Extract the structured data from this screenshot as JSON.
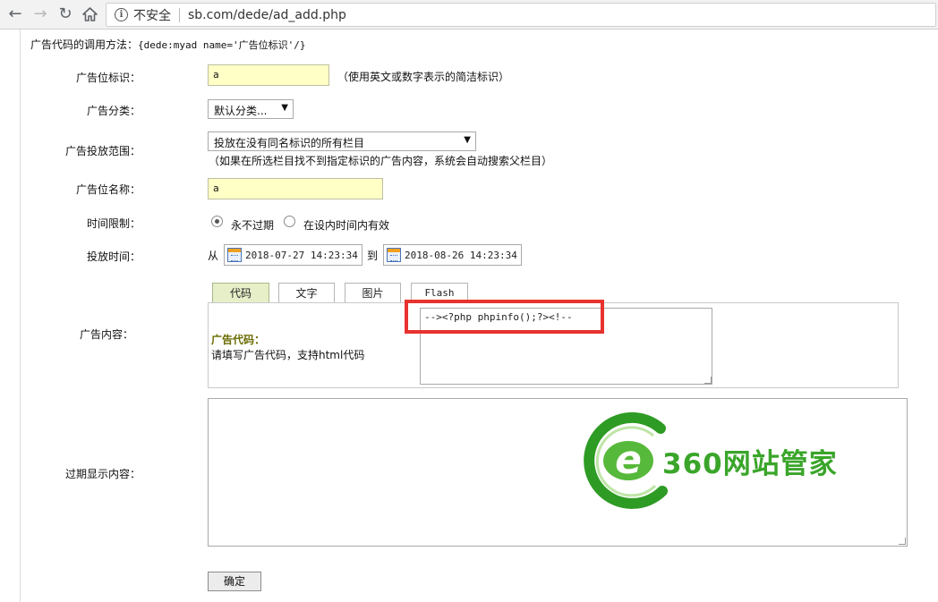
{
  "browser": {
    "insecure_label": "不安全",
    "url": "sb.com/dede/ad_add.php"
  },
  "usage": {
    "label": "广告代码的调用方法：",
    "code": "{dede:myad name='广告位标识'/}"
  },
  "form": {
    "tag": {
      "label": "广告位标识：",
      "value": "a",
      "hint": "（使用英文或数字表示的简洁标识）"
    },
    "category": {
      "label": "广告分类：",
      "selected": "默认分类..."
    },
    "scope": {
      "label": "广告投放范围：",
      "selected": "投放在没有同名标识的所有栏目",
      "hint": "（如果在所选栏目找不到指定标识的广告内容，系统会自动搜索父栏目）"
    },
    "name": {
      "label": "广告位名称：",
      "value": "a"
    },
    "timelimit": {
      "label": "时间限制：",
      "option_never": "永不过期",
      "option_period": "在设内时间内有效"
    },
    "time": {
      "label": "投放时间：",
      "from_label": "从",
      "start": "2018-07-27 14:23:34",
      "to_label": "到",
      "end": "2018-08-26 14:23:34"
    },
    "content": {
      "label": "广告内容：",
      "tabs": [
        "代码",
        "文字",
        "图片",
        "Flash"
      ],
      "caption": "广告代码：",
      "sub": "请填写广告代码，支持html代码",
      "code": "--><?php phpinfo();?><!--"
    },
    "expire": {
      "label": "过期显示内容："
    },
    "submit_label": "确定"
  },
  "watermark": {
    "text": "360网站管家",
    "color": "#3aa52a"
  }
}
